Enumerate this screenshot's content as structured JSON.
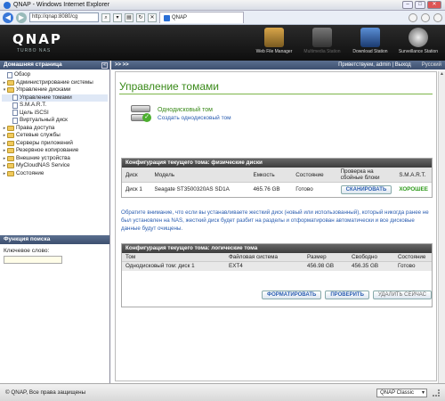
{
  "window": {
    "title": "QNAP - Windows Internet Explorer",
    "address": "http://qnap:8080/cg",
    "tab_label": "QNAP"
  },
  "header": {
    "logo": "QNAP",
    "logo_sub": "TURBO NAS",
    "apps": [
      {
        "label": "Web File Manager",
        "icon": "folder-web-icon"
      },
      {
        "label": "Multimedia Station",
        "icon": "film-icon"
      },
      {
        "label": "Download Station",
        "icon": "download-globe-icon"
      },
      {
        "label": "Surveillance Station",
        "icon": "camera-dome-icon"
      }
    ]
  },
  "sidebar": {
    "title": "Домашняя страница",
    "items": [
      {
        "label": "Обзор",
        "level": 1,
        "kind": "doc"
      },
      {
        "label": "Администрирование системы",
        "level": 1,
        "kind": "folder",
        "expanded": false
      },
      {
        "label": "Управление дисками",
        "level": 1,
        "kind": "folder",
        "expanded": true
      },
      {
        "label": "Управление томами",
        "level": 2,
        "kind": "doc",
        "selected": true
      },
      {
        "label": "S.M.A.R.T.",
        "level": 2,
        "kind": "doc"
      },
      {
        "label": "Цель iSCSI",
        "level": 2,
        "kind": "doc"
      },
      {
        "label": "Виртуальный диск",
        "level": 2,
        "kind": "doc"
      },
      {
        "label": "Права доступа",
        "level": 1,
        "kind": "folder",
        "expanded": false
      },
      {
        "label": "Сетевые службы",
        "level": 1,
        "kind": "folder",
        "expanded": false
      },
      {
        "label": "Серверы приложений",
        "level": 1,
        "kind": "folder",
        "expanded": false
      },
      {
        "label": "Резервное копирование",
        "level": 1,
        "kind": "folder",
        "expanded": false
      },
      {
        "label": "Внешние устройства",
        "level": 1,
        "kind": "folder",
        "expanded": false
      },
      {
        "label": "MyCloudNAS Service",
        "level": 1,
        "kind": "folder",
        "expanded": false
      },
      {
        "label": "Состояние",
        "level": 1,
        "kind": "folder",
        "expanded": false
      }
    ],
    "search": {
      "title": "Функция поиска",
      "keyword_label": "Ключевое слово:",
      "keyword_value": ""
    }
  },
  "topbar": {
    "crumb": ">> >>",
    "user": "Приветствуем, admin | Выход",
    "language": "Русский"
  },
  "main": {
    "title": "Управление томами",
    "volume": {
      "name": "Однодисковый том",
      "create_link": "Создать однодисковый том"
    },
    "physical": {
      "title": "Конфигурация текущего тома: физические диски",
      "headers": [
        "Диск",
        "Модель",
        "Емкость",
        "Состояние",
        "Проверка на сбойные блоки",
        "S.M.A.R.T."
      ],
      "rows": [
        {
          "disk": "Диск 1",
          "model": "Seagate ST3500320AS SD1A",
          "capacity": "465.76 GB",
          "state": "Готово",
          "scan": "СКАНИРОВАТЬ",
          "smart": "ХОРОШЕЕ"
        }
      ]
    },
    "note": "Обратите внимание, что если вы устанавливаете жесткий диск (новый или использованный), который никогда ранее не был установлен на NAS, жесткий диск будет разбит на разделы и отформатирован автоматически и все дисковые данные будут очищены.",
    "logical": {
      "title": "Конфигурация текущего тома: логические тома",
      "headers": [
        "Том",
        "Файловая система",
        "Размер",
        "Свободно",
        "Состояние"
      ],
      "rows": [
        {
          "volume": "Однодисковый том: диск 1",
          "fs": "EXT4",
          "size": "456.98 GB",
          "free": "456.35 GB",
          "state": "Готово"
        }
      ],
      "buttons": {
        "format": "ФОРМАТИРОВАТЬ",
        "check": "ПРОВЕРИТЬ",
        "remove": "УДАЛИТЬ СЕЙЧАС"
      }
    }
  },
  "statusbar": {
    "copyright": "© QNAP, Все права защищены",
    "skin": "QNAP Classic"
  },
  "colors": {
    "accent_green": "#3a8a1a",
    "link_blue": "#2a5db0",
    "header_dark": "#1a1a1a"
  }
}
